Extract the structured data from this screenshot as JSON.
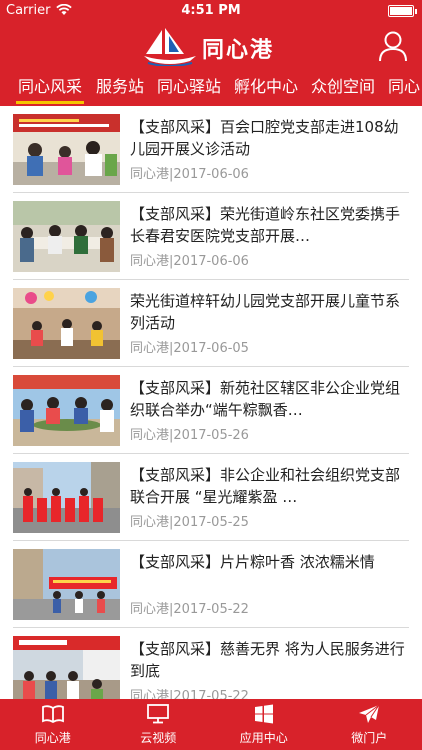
{
  "status_bar": {
    "carrier": "Carrier",
    "time": "4:51 PM"
  },
  "header": {
    "title": "同心港",
    "logo": "sailboat-logo",
    "user_icon": "user-icon"
  },
  "tabs": [
    {
      "label": "同心风采",
      "active": true
    },
    {
      "label": "服务站",
      "active": false
    },
    {
      "label": "同心驿站",
      "active": false
    },
    {
      "label": "孵化中心",
      "active": false
    },
    {
      "label": "众创空间",
      "active": false
    },
    {
      "label": "同心",
      "active": false
    }
  ],
  "feed": [
    {
      "title": "【支部风采】百会口腔党支部走进108幼儿园开展义诊活动",
      "source": "同心港",
      "date": "2017-06-06"
    },
    {
      "title": "【支部风采】荣光街道岭东社区党委携手长春君安医院党支部开展…",
      "source": "同心港",
      "date": "2017-06-06"
    },
    {
      "title": "荣光街道梓轩幼儿园党支部开展儿童节系列活动",
      "source": "同心港",
      "date": "2017-06-05"
    },
    {
      "title": "【支部风采】新苑社区辖区非公企业党组织联合举办“端午粽飘香…",
      "source": "同心港",
      "date": "2017-05-26"
    },
    {
      "title": "【支部风采】非公企业和社会组织党支部联合开展 “星光耀紫盈 …",
      "source": "同心港",
      "date": "2017-05-25"
    },
    {
      "title": "【支部风采】片片粽叶香 浓浓糯米情",
      "source": "同心港",
      "date": "2017-05-22"
    },
    {
      "title": "【支部风采】慈善无界 将为人民服务进行到底",
      "source": "同心港",
      "date": "2017-05-22"
    }
  ],
  "tabbar": [
    {
      "label": "同心港",
      "icon": "book-icon"
    },
    {
      "label": "云视频",
      "icon": "monitor-icon"
    },
    {
      "label": "应用中心",
      "icon": "windows-icon"
    },
    {
      "label": "微门户",
      "icon": "paper-plane-icon"
    }
  ],
  "colors": {
    "brand_red": "#d8222a",
    "tab_underline": "#f5c400",
    "date_gray": "#999999"
  }
}
